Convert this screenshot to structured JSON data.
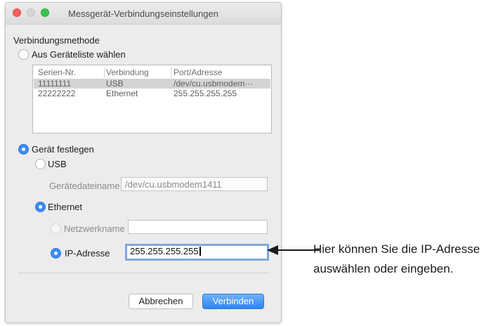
{
  "window": {
    "title": "Messgerät-Verbindungseinstellungen"
  },
  "connection_method": {
    "heading": "Verbindungsmethode",
    "option_list": {
      "label": "Aus Geräteliste wählen",
      "selected": false
    },
    "device_list": {
      "columns": [
        "Serien-Nr.",
        "Verbindung",
        "Port/Adresse"
      ],
      "rows": [
        {
          "serial": "11111111",
          "connection": "USB",
          "port": "/dev/cu.usbmodem···",
          "selected": true
        },
        {
          "serial": "22222222",
          "connection": "Ethernet",
          "port": "255.255.255.255",
          "selected": false
        }
      ]
    },
    "option_fixed": {
      "label": "Gerät festlegen",
      "selected": true
    },
    "usb": {
      "label": "USB",
      "selected": false,
      "device_file_label": "Gerätedateiname",
      "device_file_value": "/dev/cu.usbmodem1411"
    },
    "ethernet": {
      "label": "Ethernet",
      "selected": true,
      "network_name_label": "Netzwerkname",
      "network_name_value": "",
      "ip_label": "IP-Adresse",
      "ip_value": "255.255.255.255"
    }
  },
  "buttons": {
    "cancel": "Abbrechen",
    "connect": "Verbinden"
  },
  "annotation": {
    "line1": "Hier können Sie die IP-Adresse",
    "line2": "auswählen oder eingeben."
  },
  "colors": {
    "accent": "#3b8df0",
    "close": "#fc605c",
    "maximize": "#34c84a"
  }
}
